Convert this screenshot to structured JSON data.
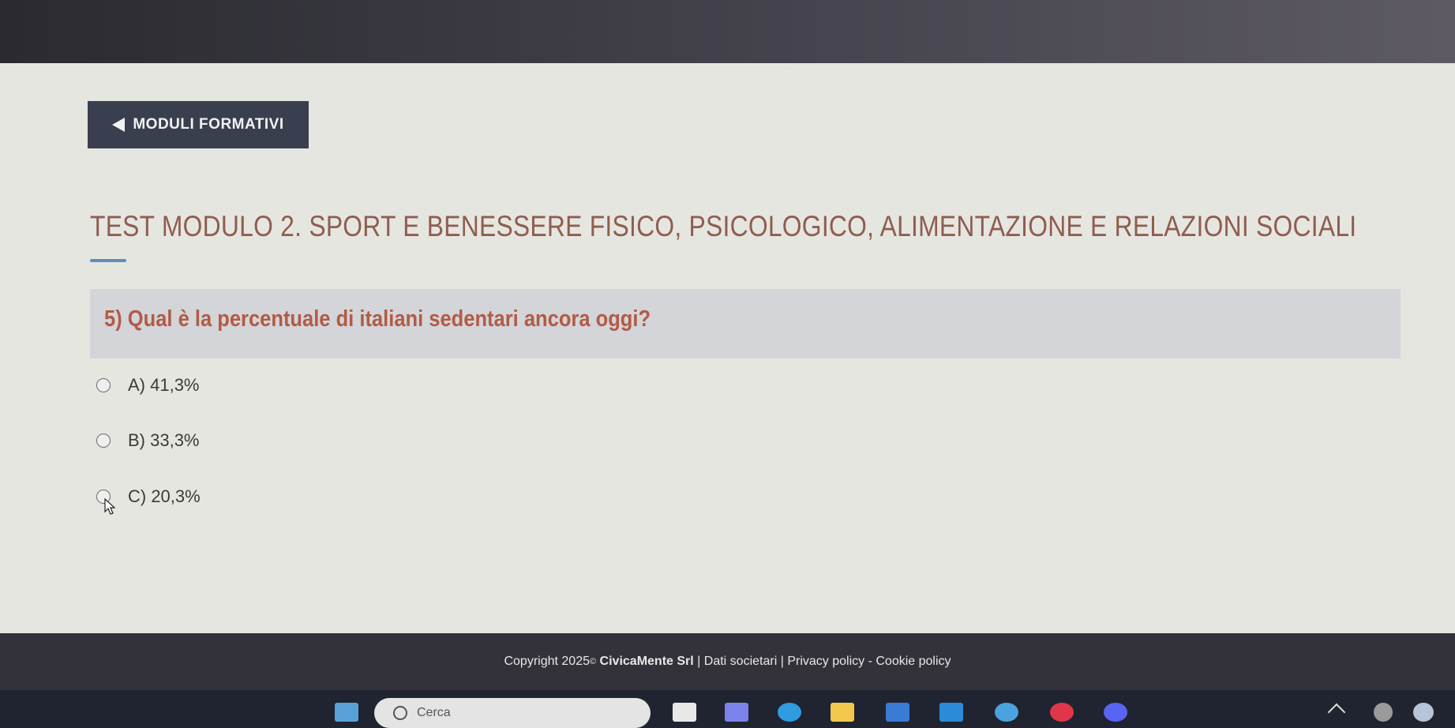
{
  "nav": {
    "back_label": "MODULI FORMATIVI"
  },
  "page": {
    "title": "TEST MODULO 2. SPORT E BENESSERE FISICO, PSICOLOGICO, ALIMENTAZIONE E RELAZIONI SOCIALI"
  },
  "question": {
    "text": "5) Qual è la percentuale di italiani sedentari ancora oggi?",
    "options": [
      {
        "label": "A) 41,3%"
      },
      {
        "label": "B) 33,3%"
      },
      {
        "label": "C) 20,3%"
      }
    ]
  },
  "footer": {
    "copyright": "Copyright 2025",
    "copyright_symbol": "©",
    "company": "CivicaMente Srl",
    "sep": "|",
    "links": [
      "Dati societari",
      "Privacy policy",
      "Cookie policy"
    ],
    "dash": "-"
  },
  "taskbar": {
    "search_placeholder": "Cerca",
    "icons": [
      "widgets-icon",
      "task-view-icon",
      "teams-icon",
      "edge-icon",
      "file-explorer-icon",
      "store-icon",
      "mail-icon",
      "app-icon",
      "opera-icon",
      "discord-icon",
      "chevron-up-icon",
      "tray-icon",
      "copilot-icon"
    ]
  },
  "colors": {
    "title": "#8f5d4f",
    "question": "#b25b45",
    "accent": "#5e8fb8",
    "button_bg": "#3a3f50"
  }
}
